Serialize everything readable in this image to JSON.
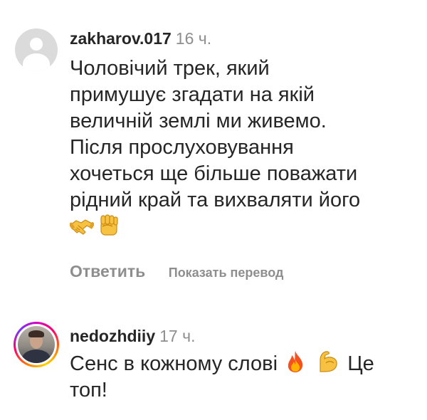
{
  "comments": [
    {
      "username": "zakharov.017",
      "time": "16 ч.",
      "text_lines": [
        "Чоловічий трек, який",
        "примушує згадати на якій",
        "величній землі ми живемо.",
        "Після прослуховування",
        "хочеться ще більше поважати",
        "рідний край та вихваляти його"
      ],
      "emojis": [
        "handshake-emoji",
        "raised-fist-emoji"
      ],
      "reply_label": "Ответить",
      "translate_label": "Показать перевод",
      "avatar": "default-avatar"
    },
    {
      "username": "nedozhdiiy",
      "time": "17 ч.",
      "text_line1_start": "Сенс в кожному слові",
      "text_line1_end": "Це",
      "text_line2": "топ!",
      "emojis": [
        "fire-emoji",
        "flexed-biceps-emoji"
      ],
      "avatar": "photo-avatar-with-story-ring"
    }
  ],
  "colors": {
    "text": "#262626",
    "secondary": "#8e8e8e",
    "avatar_placeholder": "#dbdbdb"
  }
}
